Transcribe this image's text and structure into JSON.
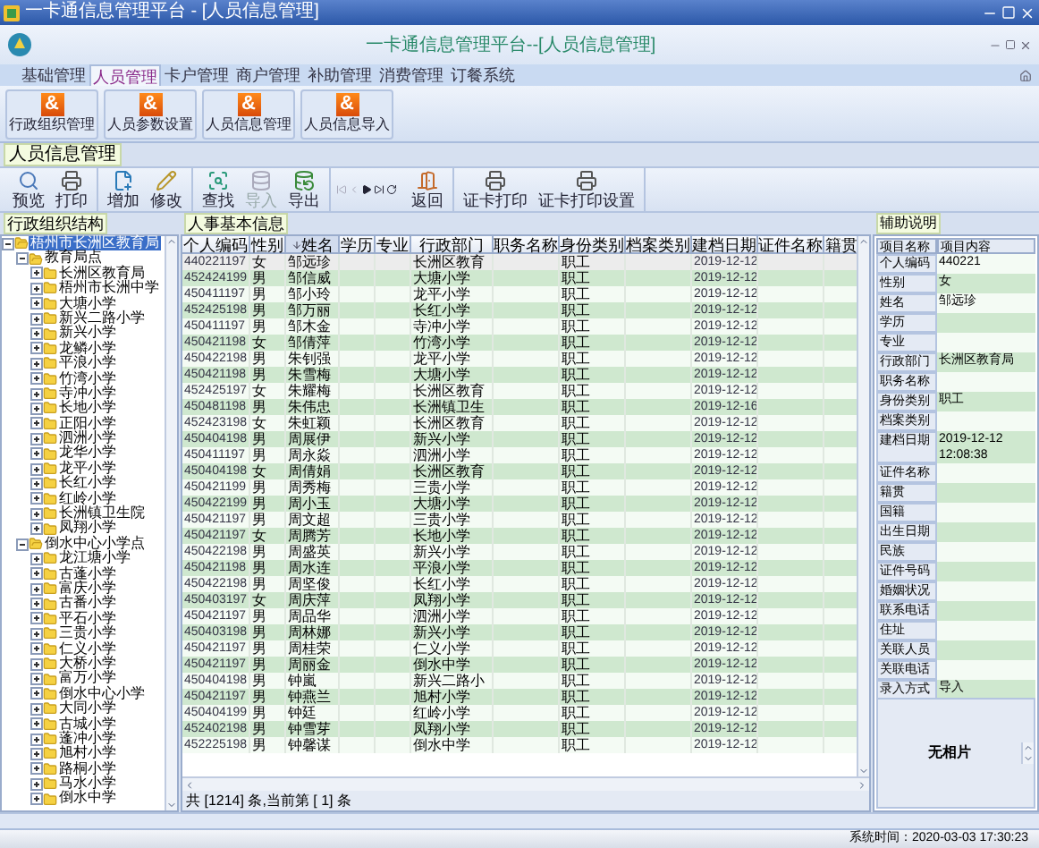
{
  "window": {
    "title": "一卡通信息管理平台 - [人员信息管理]"
  },
  "app_title": "一卡通信息管理平台--[人员信息管理]",
  "tabs": [
    {
      "label": "基础管理",
      "selected": false
    },
    {
      "label": "人员管理",
      "selected": true
    },
    {
      "label": "卡户管理",
      "selected": false
    },
    {
      "label": "商户管理",
      "selected": false
    },
    {
      "label": "补助管理",
      "selected": false
    },
    {
      "label": "消费管理",
      "selected": false
    },
    {
      "label": "订餐系统",
      "selected": false
    }
  ],
  "ribbon": [
    {
      "label": "行政组织管理",
      "glyph": "&"
    },
    {
      "label": "人员参数设置",
      "glyph": "&"
    },
    {
      "label": "人员信息管理",
      "glyph": "&"
    },
    {
      "label": "人员信息导入",
      "glyph": "&"
    }
  ],
  "section_title": "人员信息管理",
  "toolbar": [
    {
      "items": [
        {
          "kind": "button",
          "label": "预览",
          "disabled": false
        },
        {
          "kind": "button",
          "label": "打印",
          "disabled": false
        }
      ]
    },
    {
      "items": [
        {
          "kind": "button",
          "label": "增加",
          "disabled": false
        },
        {
          "kind": "button",
          "label": "修改",
          "disabled": false
        }
      ]
    },
    {
      "items": [
        {
          "kind": "button",
          "label": "查找",
          "disabled": false
        },
        {
          "kind": "button",
          "label": "导入",
          "disabled": true
        },
        {
          "kind": "button",
          "label": "导出",
          "disabled": false
        }
      ]
    },
    {
      "items": [
        {
          "kind": "nav"
        },
        {
          "kind": "button",
          "label": "返回",
          "disabled": false
        }
      ]
    },
    {
      "items": [
        {
          "kind": "button",
          "label": "证卡打印",
          "disabled": false
        },
        {
          "kind": "button",
          "label": "证卡打印设置",
          "disabled": false
        }
      ]
    }
  ],
  "tree_title": "行政组织结构",
  "tree": [
    {
      "label": "梧州市长洲区教育局",
      "expanded": true,
      "selected": true,
      "children": [
        {
          "label": "教育局点",
          "expanded": true,
          "selected": false,
          "children": [
            {
              "label": "长洲区教育局",
              "expanded": false,
              "selected": false
            },
            {
              "label": "梧州市长洲中学",
              "expanded": false,
              "selected": false
            },
            {
              "label": "大塘小学",
              "expanded": false,
              "selected": false
            },
            {
              "label": "新兴二路小学",
              "expanded": false,
              "selected": false
            },
            {
              "label": "新兴小学",
              "expanded": false,
              "selected": false
            },
            {
              "label": "龙鳞小学",
              "expanded": false,
              "selected": false
            },
            {
              "label": "平浪小学",
              "expanded": false,
              "selected": false
            },
            {
              "label": "竹湾小学",
              "expanded": false,
              "selected": false
            },
            {
              "label": "寺冲小学",
              "expanded": false,
              "selected": false
            },
            {
              "label": "长地小学",
              "expanded": false,
              "selected": false
            },
            {
              "label": "正阳小学",
              "expanded": false,
              "selected": false
            },
            {
              "label": "泗洲小学",
              "expanded": false,
              "selected": false
            },
            {
              "label": "龙华小学",
              "expanded": false,
              "selected": false
            },
            {
              "label": "龙平小学",
              "expanded": false,
              "selected": false
            },
            {
              "label": "长红小学",
              "expanded": false,
              "selected": false
            },
            {
              "label": "红岭小学",
              "expanded": false,
              "selected": false
            },
            {
              "label": "长洲镇卫生院",
              "expanded": false,
              "selected": false
            },
            {
              "label": "凤翔小学",
              "expanded": false,
              "selected": false
            }
          ]
        },
        {
          "label": "倒水中心小学点",
          "expanded": true,
          "selected": false,
          "children": [
            {
              "label": "龙江塘小学",
              "expanded": false,
              "selected": false
            },
            {
              "label": "古蓬小学",
              "expanded": false,
              "selected": false
            },
            {
              "label": "富庆小学",
              "expanded": false,
              "selected": false
            },
            {
              "label": "古番小学",
              "expanded": false,
              "selected": false
            },
            {
              "label": "平石小学",
              "expanded": false,
              "selected": false
            },
            {
              "label": "三贵小学",
              "expanded": false,
              "selected": false
            },
            {
              "label": "仁义小学",
              "expanded": false,
              "selected": false
            },
            {
              "label": "大桥小学",
              "expanded": false,
              "selected": false
            },
            {
              "label": "富万小学",
              "expanded": false,
              "selected": false
            },
            {
              "label": "倒水中心小学",
              "expanded": false,
              "selected": false
            },
            {
              "label": "大同小学",
              "expanded": false,
              "selected": false
            },
            {
              "label": "古城小学",
              "expanded": false,
              "selected": false
            },
            {
              "label": "蓬冲小学",
              "expanded": false,
              "selected": false
            },
            {
              "label": "旭村小学",
              "expanded": false,
              "selected": false
            },
            {
              "label": "路桐小学",
              "expanded": false,
              "selected": false
            },
            {
              "label": "马水小学",
              "expanded": false,
              "selected": false
            },
            {
              "label": "倒水中学",
              "expanded": false,
              "selected": false
            }
          ]
        }
      ]
    }
  ],
  "table_title": "人事基本信息",
  "table": {
    "columns": [
      {
        "label": "个人编码",
        "sorted": false
      },
      {
        "label": "性别",
        "sorted": false
      },
      {
        "label": "姓名",
        "sorted": true
      },
      {
        "label": "学历",
        "sorted": false
      },
      {
        "label": "专业",
        "sorted": false
      },
      {
        "label": "行政部门",
        "sorted": false
      },
      {
        "label": "职务名称",
        "sorted": false
      },
      {
        "label": "身份类别",
        "sorted": false
      },
      {
        "label": "档案类别",
        "sorted": false
      },
      {
        "label": "建档日期",
        "sorted": false
      },
      {
        "label": "证件名称",
        "sorted": false
      },
      {
        "label": "籍贯",
        "sorted": false
      }
    ],
    "rows": [
      {
        "code": "440221197",
        "sex": "女",
        "name": "邹远珍",
        "dept": "长洲区教育",
        "category": "职工",
        "date": "2019-12-12",
        "selected": true
      },
      {
        "code": "452424199",
        "sex": "男",
        "name": "邹信威",
        "dept": "大塘小学",
        "category": "职工",
        "date": "2019-12-12",
        "selected": false
      },
      {
        "code": "450411197",
        "sex": "男",
        "name": "邹小玲",
        "dept": "龙平小学",
        "category": "职工",
        "date": "2019-12-12",
        "selected": false
      },
      {
        "code": "452425198",
        "sex": "男",
        "name": "邹万丽",
        "dept": "长红小学",
        "category": "职工",
        "date": "2019-12-12",
        "selected": false
      },
      {
        "code": "450411197",
        "sex": "男",
        "name": "邹木金",
        "dept": "寺冲小学",
        "category": "职工",
        "date": "2019-12-12",
        "selected": false
      },
      {
        "code": "450421198",
        "sex": "女",
        "name": "邹倩萍",
        "dept": "竹湾小学",
        "category": "职工",
        "date": "2019-12-12",
        "selected": false
      },
      {
        "code": "450422198",
        "sex": "男",
        "name": "朱钊强",
        "dept": "龙平小学",
        "category": "职工",
        "date": "2019-12-12",
        "selected": false
      },
      {
        "code": "450421198",
        "sex": "男",
        "name": "朱雪梅",
        "dept": "大塘小学",
        "category": "职工",
        "date": "2019-12-12",
        "selected": false
      },
      {
        "code": "452425197",
        "sex": "女",
        "name": "朱耀梅",
        "dept": "长洲区教育",
        "category": "职工",
        "date": "2019-12-12",
        "selected": false
      },
      {
        "code": "450481198",
        "sex": "男",
        "name": "朱伟忠",
        "dept": "长洲镇卫生",
        "category": "职工",
        "date": "2019-12-16",
        "selected": false
      },
      {
        "code": "452423198",
        "sex": "女",
        "name": "朱虹颖",
        "dept": "长洲区教育",
        "category": "职工",
        "date": "2019-12-12",
        "selected": false
      },
      {
        "code": "450404198",
        "sex": "男",
        "name": "周展伊",
        "dept": "新兴小学",
        "category": "职工",
        "date": "2019-12-12",
        "selected": false
      },
      {
        "code": "450411197",
        "sex": "男",
        "name": "周永焱",
        "dept": "泗洲小学",
        "category": "职工",
        "date": "2019-12-12",
        "selected": false
      },
      {
        "code": "450404198",
        "sex": "女",
        "name": "周倩娟",
        "dept": "长洲区教育",
        "category": "职工",
        "date": "2019-12-12",
        "selected": false
      },
      {
        "code": "450421199",
        "sex": "男",
        "name": "周秀梅",
        "dept": "三贵小学",
        "category": "职工",
        "date": "2019-12-12",
        "selected": false
      },
      {
        "code": "450422199",
        "sex": "男",
        "name": "周小玉",
        "dept": "大塘小学",
        "category": "职工",
        "date": "2019-12-12",
        "selected": false
      },
      {
        "code": "450421197",
        "sex": "男",
        "name": "周文超",
        "dept": "三贵小学",
        "category": "职工",
        "date": "2019-12-12",
        "selected": false
      },
      {
        "code": "450421197",
        "sex": "女",
        "name": "周腾芳",
        "dept": "长地小学",
        "category": "职工",
        "date": "2019-12-12",
        "selected": false
      },
      {
        "code": "450422198",
        "sex": "男",
        "name": "周盛英",
        "dept": "新兴小学",
        "category": "职工",
        "date": "2019-12-12",
        "selected": false
      },
      {
        "code": "450421198",
        "sex": "男",
        "name": "周水连",
        "dept": "平浪小学",
        "category": "职工",
        "date": "2019-12-12",
        "selected": false
      },
      {
        "code": "450422198",
        "sex": "男",
        "name": "周坚俊",
        "dept": "长红小学",
        "category": "职工",
        "date": "2019-12-12",
        "selected": false
      },
      {
        "code": "450403197",
        "sex": "女",
        "name": "周庆萍",
        "dept": "凤翔小学",
        "category": "职工",
        "date": "2019-12-12",
        "selected": false
      },
      {
        "code": "450421197",
        "sex": "男",
        "name": "周品华",
        "dept": "泗洲小学",
        "category": "职工",
        "date": "2019-12-12",
        "selected": false
      },
      {
        "code": "450403198",
        "sex": "男",
        "name": "周林娜",
        "dept": "新兴小学",
        "category": "职工",
        "date": "2019-12-12",
        "selected": false
      },
      {
        "code": "450421197",
        "sex": "男",
        "name": "周桂荣",
        "dept": "仁义小学",
        "category": "职工",
        "date": "2019-12-12",
        "selected": false
      },
      {
        "code": "450421197",
        "sex": "男",
        "name": "周丽金",
        "dept": "倒水中学",
        "category": "职工",
        "date": "2019-12-12",
        "selected": false
      },
      {
        "code": "450404198",
        "sex": "男",
        "name": "钟嵐",
        "dept": "新兴二路小",
        "category": "职工",
        "date": "2019-12-12",
        "selected": false
      },
      {
        "code": "450421197",
        "sex": "男",
        "name": "钟燕兰",
        "dept": "旭村小学",
        "category": "职工",
        "date": "2019-12-12",
        "selected": false
      },
      {
        "code": "450404199",
        "sex": "男",
        "name": "钟廷",
        "dept": "红岭小学",
        "category": "职工",
        "date": "2019-12-12",
        "selected": false
      },
      {
        "code": "452402198",
        "sex": "男",
        "name": "钟雪芽",
        "dept": "凤翔小学",
        "category": "职工",
        "date": "2019-12-12",
        "selected": false
      },
      {
        "code": "452225198",
        "sex": "男",
        "name": "钟馨谋",
        "dept": "倒水中学",
        "category": "职工",
        "date": "2019-12-12",
        "selected": false
      }
    ]
  },
  "table_status": "共 [1214] 条,当前第 [ 1] 条",
  "detail": {
    "tab": "辅助说明",
    "columns": [
      "项目名称",
      "项目内容"
    ],
    "rows": [
      {
        "label": "个人编码",
        "value": "440221"
      },
      {
        "label": "性别",
        "value": "女"
      },
      {
        "label": "姓名",
        "value": "邹远珍"
      },
      {
        "label": "学历"
      },
      {
        "label": "专业"
      },
      {
        "label": "行政部门",
        "value": "长洲区教育局"
      },
      {
        "label": "职务名称"
      },
      {
        "label": "身份类别",
        "value": "职工"
      },
      {
        "label": "档案类别"
      },
      {
        "label": "建档日期",
        "value": "2019-12-12 12:08:38"
      },
      {
        "label": "证件名称"
      },
      {
        "label": "籍贯"
      },
      {
        "label": "国籍"
      },
      {
        "label": "出生日期"
      },
      {
        "label": "民族"
      },
      {
        "label": "证件号码"
      },
      {
        "label": "婚姻状况"
      },
      {
        "label": "联系电话"
      },
      {
        "label": "住址"
      },
      {
        "label": "关联人员"
      },
      {
        "label": "关联电话"
      },
      {
        "label": "录入方式",
        "value": "导入"
      }
    ],
    "photo": "无相片"
  },
  "status_bar": {
    "time": "系统时间：2020-03-03 17:30:23"
  }
}
